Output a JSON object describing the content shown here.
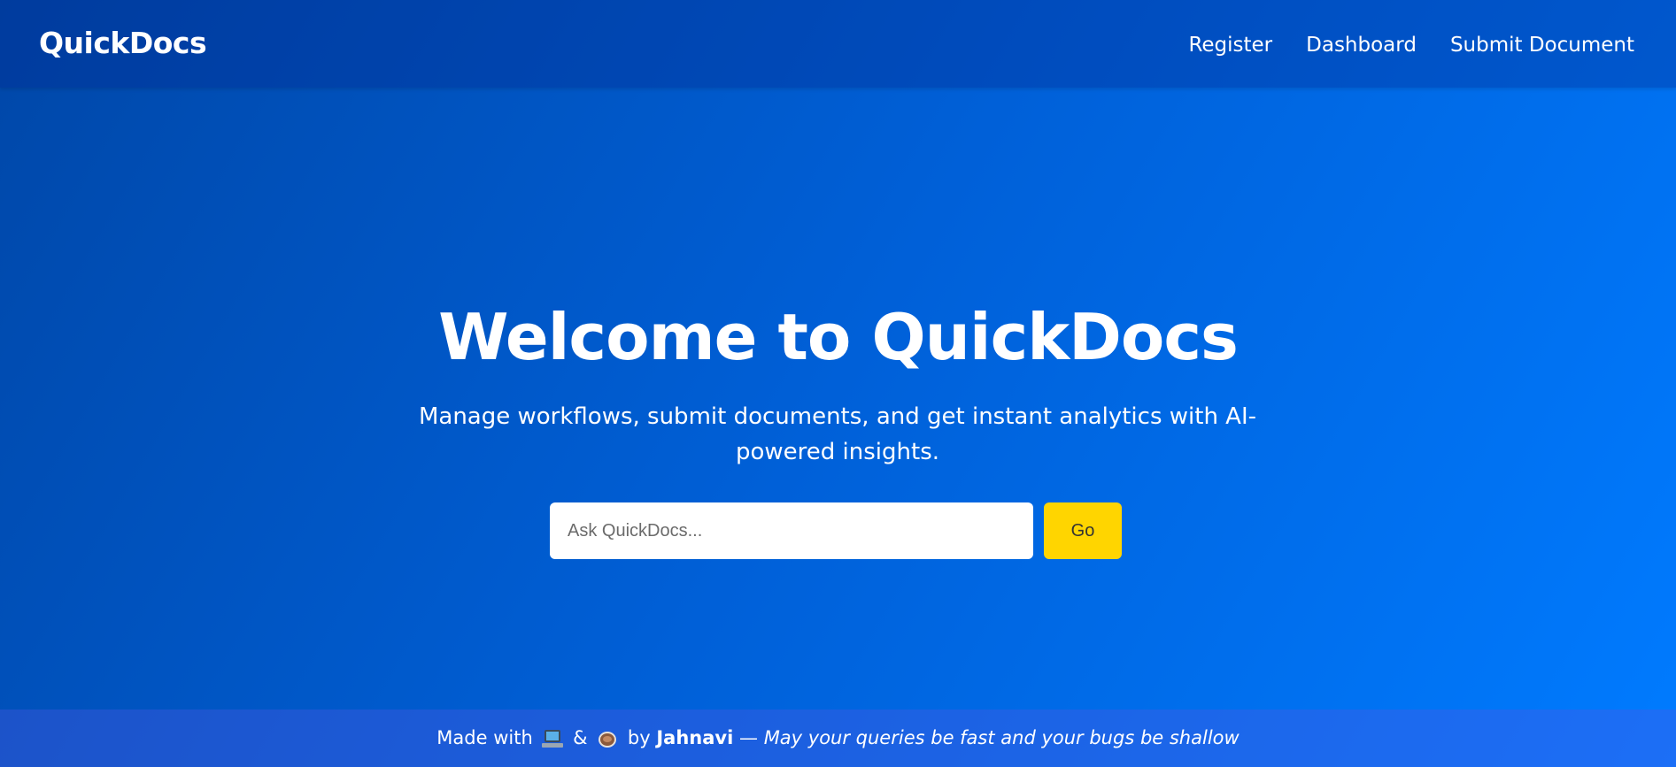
{
  "nav": {
    "brand": "QuickDocs",
    "links": [
      "Register",
      "Dashboard",
      "Submit Document"
    ]
  },
  "hero": {
    "title": "Welcome to QuickDocs",
    "subtitle": "Manage workflows, submit documents, and get instant analytics with AI-powered insights.",
    "search": {
      "placeholder": "Ask QuickDocs...",
      "value": "",
      "button_label": "Go"
    }
  },
  "footer": {
    "made_with": "Made with",
    "amp": "&",
    "by": "by",
    "author": "Jahnavi",
    "dash": "—",
    "tagline": "May your queries be fast and your bugs be shallow",
    "icons": [
      "laptop-icon",
      "coffee-icon"
    ]
  },
  "colors": {
    "background_start": "#0047a8",
    "background_end": "#007bff",
    "button": "#ffd500",
    "text": "#ffffff"
  }
}
